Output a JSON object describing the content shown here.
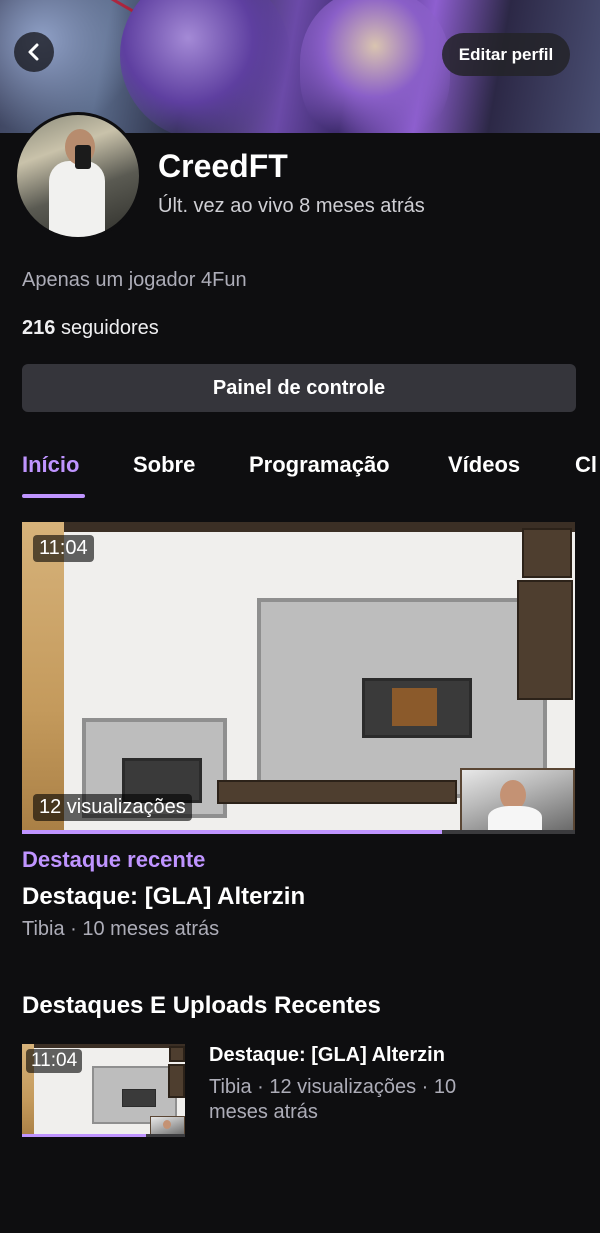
{
  "header": {
    "back_label": "‹",
    "edit_profile_label": "Editar perfil"
  },
  "channel": {
    "name": "CreedFT",
    "last_live": "Últ. vez ao vivo 8 meses atrás",
    "bio": "Apenas um jogador 4Fun",
    "followers_count": "216",
    "followers_label": "seguidores"
  },
  "dashboard_button_label": "Painel de controle",
  "tabs": [
    {
      "label": "Início",
      "active": true
    },
    {
      "label": "Sobre",
      "active": false
    },
    {
      "label": "Programação",
      "active": false
    },
    {
      "label": "Vídeos",
      "active": false
    },
    {
      "label": "Cl",
      "active": false
    }
  ],
  "recent_highlight": {
    "duration": "11:04",
    "views": "12 visualizações",
    "tag": "Destaque recente",
    "title": "Destaque: [GLA] Alterzin",
    "meta": "Tibia · 10 meses atrás",
    "watched_progress": 0.76
  },
  "recent_section": {
    "title": "Destaques E Uploads Recentes",
    "items": [
      {
        "duration": "11:04",
        "title": "Destaque: [GLA] Alterzin",
        "meta": "Tibia · 12 visualizações · 10 meses atrás",
        "watched_progress": 0.76
      }
    ]
  },
  "colors": {
    "background": "#0e0e10",
    "accent": "#bf94ff",
    "button": "#35353b",
    "muted_text": "#adadb8"
  }
}
